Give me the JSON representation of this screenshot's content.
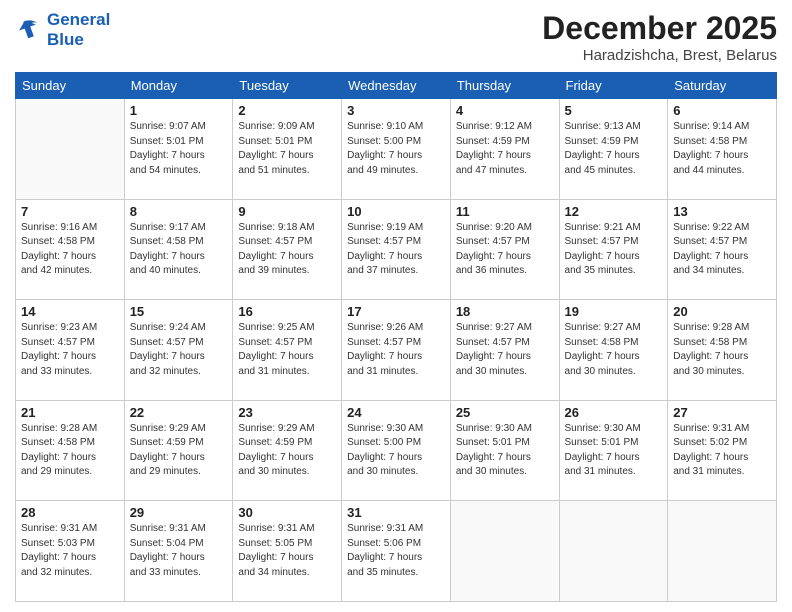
{
  "logo": {
    "line1": "General",
    "line2": "Blue"
  },
  "title": "December 2025",
  "subtitle": "Haradzishcha, Brest, Belarus",
  "days_of_week": [
    "Sunday",
    "Monday",
    "Tuesday",
    "Wednesday",
    "Thursday",
    "Friday",
    "Saturday"
  ],
  "weeks": [
    [
      {
        "day": "",
        "info": ""
      },
      {
        "day": "1",
        "info": "Sunrise: 9:07 AM\nSunset: 5:01 PM\nDaylight: 7 hours\nand 54 minutes."
      },
      {
        "day": "2",
        "info": "Sunrise: 9:09 AM\nSunset: 5:01 PM\nDaylight: 7 hours\nand 51 minutes."
      },
      {
        "day": "3",
        "info": "Sunrise: 9:10 AM\nSunset: 5:00 PM\nDaylight: 7 hours\nand 49 minutes."
      },
      {
        "day": "4",
        "info": "Sunrise: 9:12 AM\nSunset: 4:59 PM\nDaylight: 7 hours\nand 47 minutes."
      },
      {
        "day": "5",
        "info": "Sunrise: 9:13 AM\nSunset: 4:59 PM\nDaylight: 7 hours\nand 45 minutes."
      },
      {
        "day": "6",
        "info": "Sunrise: 9:14 AM\nSunset: 4:58 PM\nDaylight: 7 hours\nand 44 minutes."
      }
    ],
    [
      {
        "day": "7",
        "info": "Sunrise: 9:16 AM\nSunset: 4:58 PM\nDaylight: 7 hours\nand 42 minutes."
      },
      {
        "day": "8",
        "info": "Sunrise: 9:17 AM\nSunset: 4:58 PM\nDaylight: 7 hours\nand 40 minutes."
      },
      {
        "day": "9",
        "info": "Sunrise: 9:18 AM\nSunset: 4:57 PM\nDaylight: 7 hours\nand 39 minutes."
      },
      {
        "day": "10",
        "info": "Sunrise: 9:19 AM\nSunset: 4:57 PM\nDaylight: 7 hours\nand 37 minutes."
      },
      {
        "day": "11",
        "info": "Sunrise: 9:20 AM\nSunset: 4:57 PM\nDaylight: 7 hours\nand 36 minutes."
      },
      {
        "day": "12",
        "info": "Sunrise: 9:21 AM\nSunset: 4:57 PM\nDaylight: 7 hours\nand 35 minutes."
      },
      {
        "day": "13",
        "info": "Sunrise: 9:22 AM\nSunset: 4:57 PM\nDaylight: 7 hours\nand 34 minutes."
      }
    ],
    [
      {
        "day": "14",
        "info": "Sunrise: 9:23 AM\nSunset: 4:57 PM\nDaylight: 7 hours\nand 33 minutes."
      },
      {
        "day": "15",
        "info": "Sunrise: 9:24 AM\nSunset: 4:57 PM\nDaylight: 7 hours\nand 32 minutes."
      },
      {
        "day": "16",
        "info": "Sunrise: 9:25 AM\nSunset: 4:57 PM\nDaylight: 7 hours\nand 31 minutes."
      },
      {
        "day": "17",
        "info": "Sunrise: 9:26 AM\nSunset: 4:57 PM\nDaylight: 7 hours\nand 31 minutes."
      },
      {
        "day": "18",
        "info": "Sunrise: 9:27 AM\nSunset: 4:57 PM\nDaylight: 7 hours\nand 30 minutes."
      },
      {
        "day": "19",
        "info": "Sunrise: 9:27 AM\nSunset: 4:58 PM\nDaylight: 7 hours\nand 30 minutes."
      },
      {
        "day": "20",
        "info": "Sunrise: 9:28 AM\nSunset: 4:58 PM\nDaylight: 7 hours\nand 30 minutes."
      }
    ],
    [
      {
        "day": "21",
        "info": "Sunrise: 9:28 AM\nSunset: 4:58 PM\nDaylight: 7 hours\nand 29 minutes."
      },
      {
        "day": "22",
        "info": "Sunrise: 9:29 AM\nSunset: 4:59 PM\nDaylight: 7 hours\nand 29 minutes."
      },
      {
        "day": "23",
        "info": "Sunrise: 9:29 AM\nSunset: 4:59 PM\nDaylight: 7 hours\nand 30 minutes."
      },
      {
        "day": "24",
        "info": "Sunrise: 9:30 AM\nSunset: 5:00 PM\nDaylight: 7 hours\nand 30 minutes."
      },
      {
        "day": "25",
        "info": "Sunrise: 9:30 AM\nSunset: 5:01 PM\nDaylight: 7 hours\nand 30 minutes."
      },
      {
        "day": "26",
        "info": "Sunrise: 9:30 AM\nSunset: 5:01 PM\nDaylight: 7 hours\nand 31 minutes."
      },
      {
        "day": "27",
        "info": "Sunrise: 9:31 AM\nSunset: 5:02 PM\nDaylight: 7 hours\nand 31 minutes."
      }
    ],
    [
      {
        "day": "28",
        "info": "Sunrise: 9:31 AM\nSunset: 5:03 PM\nDaylight: 7 hours\nand 32 minutes."
      },
      {
        "day": "29",
        "info": "Sunrise: 9:31 AM\nSunset: 5:04 PM\nDaylight: 7 hours\nand 33 minutes."
      },
      {
        "day": "30",
        "info": "Sunrise: 9:31 AM\nSunset: 5:05 PM\nDaylight: 7 hours\nand 34 minutes."
      },
      {
        "day": "31",
        "info": "Sunrise: 9:31 AM\nSunset: 5:06 PM\nDaylight: 7 hours\nand 35 minutes."
      },
      {
        "day": "",
        "info": ""
      },
      {
        "day": "",
        "info": ""
      },
      {
        "day": "",
        "info": ""
      }
    ]
  ]
}
